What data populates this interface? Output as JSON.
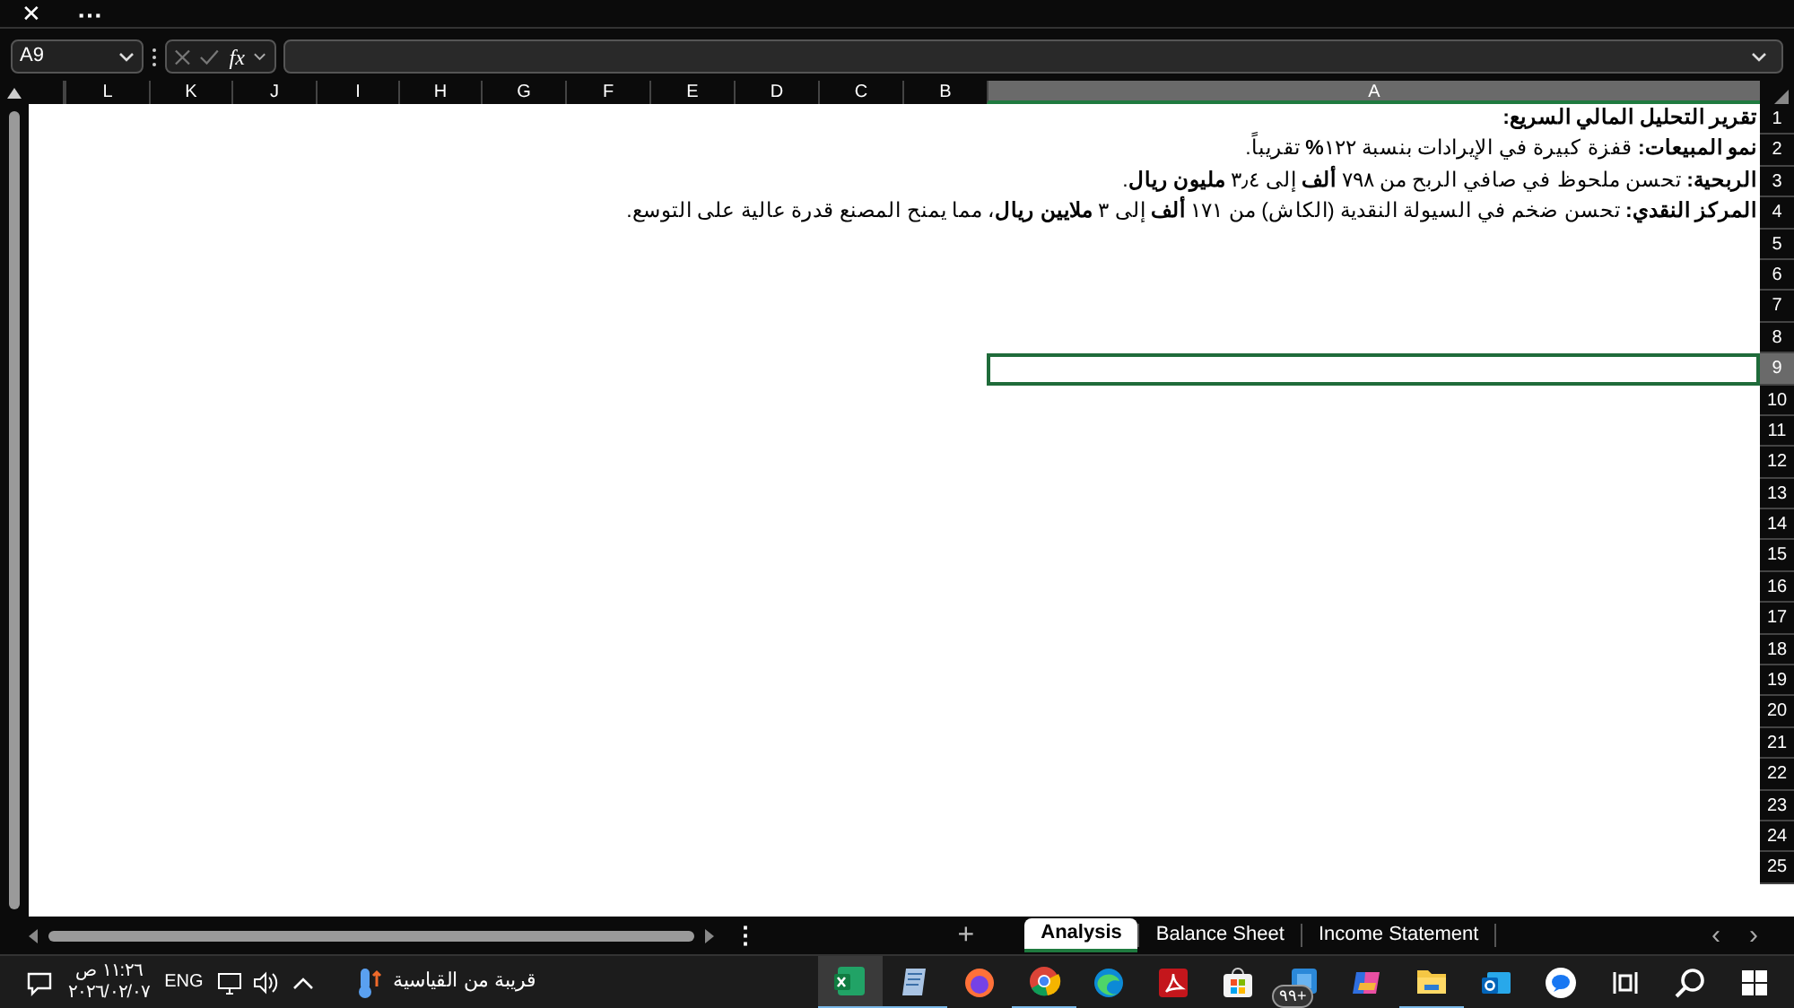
{
  "title_bar": {
    "close": "✕",
    "more": "⋯"
  },
  "formula_bar": {
    "name_box": "A9",
    "fx": "fx"
  },
  "columns": [
    {
      "label": "A",
      "selected": true
    },
    {
      "label": "B",
      "selected": false
    },
    {
      "label": "C",
      "selected": false
    },
    {
      "label": "D",
      "selected": false
    },
    {
      "label": "E",
      "selected": false
    },
    {
      "label": "F",
      "selected": false
    },
    {
      "label": "G",
      "selected": false
    },
    {
      "label": "H",
      "selected": false
    },
    {
      "label": "I",
      "selected": false
    },
    {
      "label": "J",
      "selected": false
    },
    {
      "label": "K",
      "selected": false
    },
    {
      "label": "L",
      "selected": false
    }
  ],
  "rows": [
    {
      "header": "1",
      "selected": false,
      "text": "**تقرير التحليل المالي السريع:**"
    },
    {
      "header": "2",
      "selected": false,
      "text": "**نمو المبيعات:** قفزة كبيرة في الإيرادات بنسبة ١٢٢**%** تقريباً."
    },
    {
      "header": "3",
      "selected": false,
      "text": "**الربحية:** تحسن ملحوظ في صافي الربح من ٧٩٨ **ألف** إلى ٣٫٤ **مليون ريال**."
    },
    {
      "header": "4",
      "selected": false,
      "text": "**المركز النقدي:** تحسن ضخم في السيولة النقدية (الكاش) من ١٧١ **ألف** إلى ٣ **ملايين ريال**، مما يمنح المصنع قدرة عالية على التوسع."
    },
    {
      "header": "5",
      "selected": false
    },
    {
      "header": "6",
      "selected": false
    },
    {
      "header": "7",
      "selected": false
    },
    {
      "header": "8",
      "selected": false
    },
    {
      "header": "9",
      "selected": true
    },
    {
      "header": "10",
      "selected": false
    },
    {
      "header": "11",
      "selected": false
    },
    {
      "header": "12",
      "selected": false
    },
    {
      "header": "13",
      "selected": false
    },
    {
      "header": "14",
      "selected": false
    },
    {
      "header": "15",
      "selected": false
    },
    {
      "header": "16",
      "selected": false
    },
    {
      "header": "17",
      "selected": false
    },
    {
      "header": "18",
      "selected": false
    },
    {
      "header": "19",
      "selected": false
    },
    {
      "header": "20",
      "selected": false
    },
    {
      "header": "21",
      "selected": false
    },
    {
      "header": "22",
      "selected": false
    },
    {
      "header": "23",
      "selected": false
    },
    {
      "header": "24",
      "selected": false
    },
    {
      "header": "25",
      "selected": false
    }
  ],
  "sheet_tabs": {
    "add": "+",
    "tabs": [
      {
        "label": "Income Statement",
        "selected": false
      },
      {
        "label": "Balance Sheet",
        "selected": false
      },
      {
        "label": "Analysis",
        "selected": true
      }
    ],
    "prev": "‹",
    "next": "›",
    "more": "⋮"
  },
  "taskbar": {
    "time": "١١:٢٦ ص",
    "date": "٢٠٢٦/٠٢/٠٧",
    "language": "ENG",
    "weather": "قريبة من القياسية",
    "apps": [
      {
        "kind": "spreadsheet",
        "active": true
      },
      {
        "kind": "notepad",
        "active": true
      },
      {
        "kind": "fox",
        "active": false
      },
      {
        "kind": "chrome",
        "active": true
      },
      {
        "kind": "edge",
        "active": false
      },
      {
        "kind": "pdf",
        "active": false
      },
      {
        "kind": "store",
        "active": false
      },
      {
        "kind": "badge",
        "active": false,
        "badge": "٩٩+"
      },
      {
        "kind": "copilot",
        "active": false
      },
      {
        "kind": "folder",
        "active": true
      },
      {
        "kind": "mail",
        "active": false
      },
      {
        "kind": "chat",
        "active": false
      },
      {
        "kind": "taskview",
        "active": false
      },
      {
        "kind": "search",
        "active": false
      },
      {
        "kind": "windows",
        "active": false
      }
    ]
  }
}
